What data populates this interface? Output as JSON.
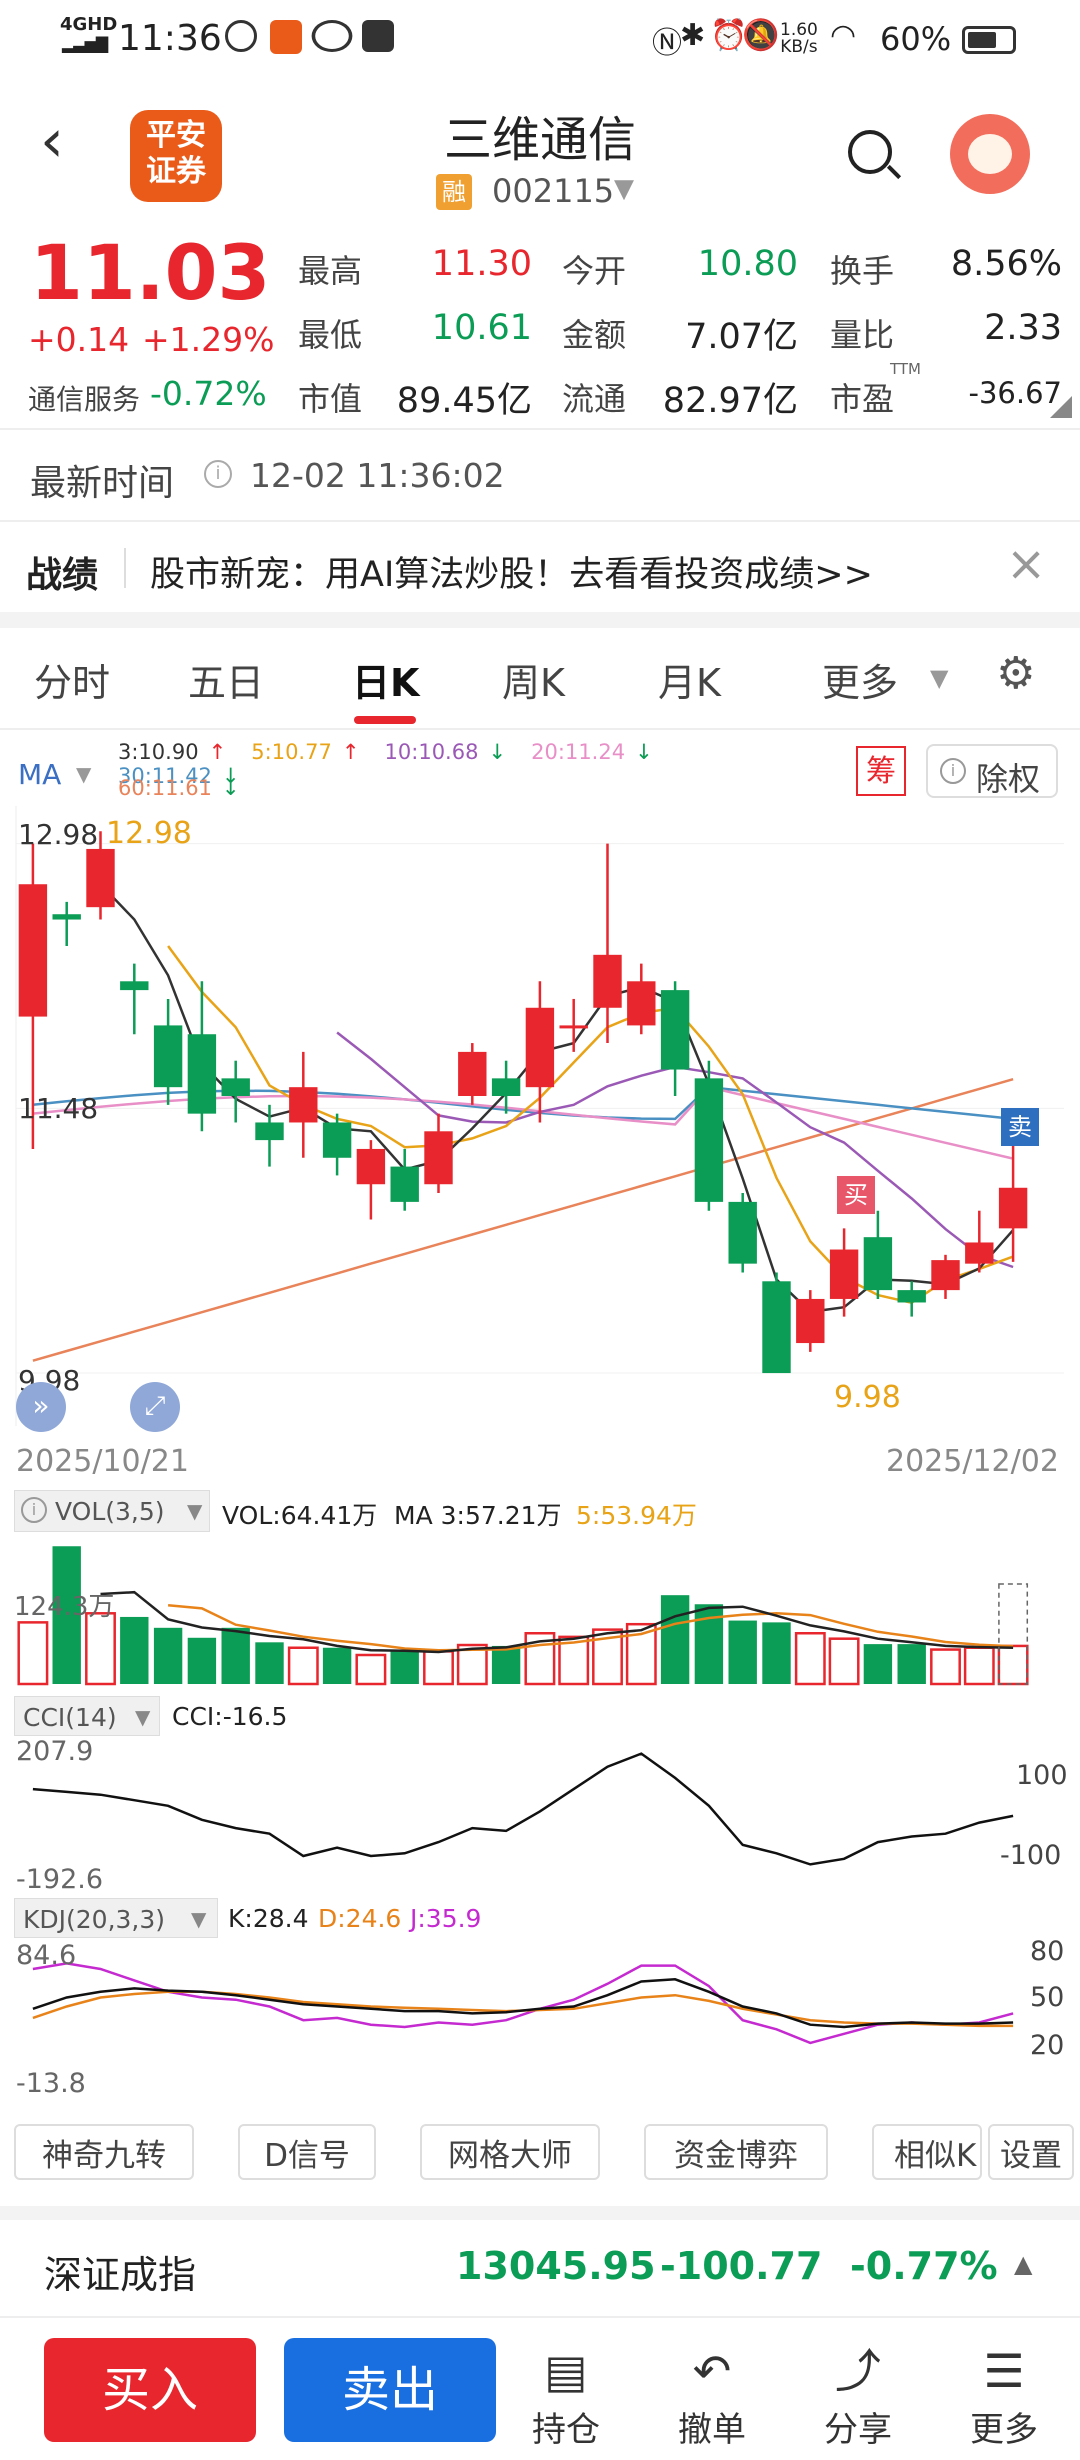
{
  "status_bar": {
    "network": "4GHD",
    "time": "11:36",
    "speed_value": "1.60",
    "speed_unit": "KB/s",
    "battery": "60%"
  },
  "header": {
    "logo_text": "平安\n证券",
    "stock_name": "三维通信",
    "margin_badge": "融",
    "stock_code": "002115"
  },
  "quote": {
    "price": "11.03",
    "change": "+0.14",
    "change_pct": "+1.29%",
    "sector": "通信服务",
    "sector_change": "-0.72%",
    "rows": [
      [
        {
          "label": "最高",
          "value": "11.30",
          "color": "red"
        },
        {
          "label": "今开",
          "value": "10.80",
          "color": "green"
        },
        {
          "label": "换手",
          "value": "8.56%",
          "color": "black"
        }
      ],
      [
        {
          "label": "最低",
          "value": "10.61",
          "color": "green"
        },
        {
          "label": "金额",
          "value": "7.07亿",
          "color": "black"
        },
        {
          "label": "量比",
          "value": "2.33",
          "color": "black"
        }
      ],
      [
        {
          "label": "市值",
          "value": "89.45亿",
          "color": "black"
        },
        {
          "label": "流通",
          "value": "82.97亿",
          "color": "black"
        },
        {
          "label": "市盈",
          "value": "-36.67",
          "color": "black",
          "sup": "TTM"
        }
      ]
    ],
    "update_label": "最新时间",
    "update_time": "12-02 11:36:02"
  },
  "promo": {
    "tag": "战绩",
    "text": "股市新宠：用AI算法炒股！去看看投资成绩>>"
  },
  "tabs": [
    {
      "label": "分时",
      "active": false
    },
    {
      "label": "五日",
      "active": false
    },
    {
      "label": "日K",
      "active": true
    },
    {
      "label": "周K",
      "active": false
    },
    {
      "label": "月K",
      "active": false
    },
    {
      "label": "更多",
      "active": false
    }
  ],
  "ma_legend": {
    "label": "MA",
    "items": [
      {
        "text": "3:10.90",
        "arrow": "↑",
        "color": "#333333"
      },
      {
        "text": "5:10.77",
        "arrow": "↑",
        "color": "#e8a317"
      },
      {
        "text": "10:10.68",
        "arrow": "↓",
        "color": "#9b59b6"
      },
      {
        "text": "20:11.24",
        "arrow": "↓",
        "color": "#e88fc7"
      },
      {
        "text": "30:11.42",
        "arrow": "↓",
        "color": "#4a90c2"
      },
      {
        "text": "60:11.61",
        "arrow": "↓",
        "color": "#e8835a"
      }
    ],
    "chip_label": "筹",
    "rights_label": "除权"
  },
  "chart_data": {
    "type": "candlestick",
    "y_axis_labels": [
      "12.98",
      "11.48",
      "9.98"
    ],
    "max_label": "12.98",
    "min_label": "9.98",
    "start_date": "2025/10/21",
    "end_date": "2025/12/02",
    "sell_marker": "卖",
    "buy_marker": "买",
    "candles": [
      {
        "o": 12.0,
        "c": 12.75,
        "h": 12.98,
        "l": 11.25
      },
      {
        "o": 12.58,
        "c": 12.55,
        "h": 12.65,
        "l": 12.4
      },
      {
        "o": 12.62,
        "c": 12.95,
        "h": 13.05,
        "l": 12.55
      },
      {
        "o": 12.2,
        "c": 12.15,
        "h": 12.3,
        "l": 11.9
      },
      {
        "o": 11.95,
        "c": 11.6,
        "h": 12.1,
        "l": 11.5
      },
      {
        "o": 11.9,
        "c": 11.45,
        "h": 12.2,
        "l": 11.35
      },
      {
        "o": 11.65,
        "c": 11.55,
        "h": 11.75,
        "l": 11.4
      },
      {
        "o": 11.4,
        "c": 11.3,
        "h": 11.5,
        "l": 11.15
      },
      {
        "o": 11.4,
        "c": 11.6,
        "h": 11.8,
        "l": 11.2
      },
      {
        "o": 11.4,
        "c": 11.2,
        "h": 11.45,
        "l": 11.1
      },
      {
        "o": 11.05,
        "c": 11.25,
        "h": 11.3,
        "l": 10.85
      },
      {
        "o": 11.15,
        "c": 10.95,
        "h": 11.25,
        "l": 10.9
      },
      {
        "o": 11.05,
        "c": 11.35,
        "h": 11.45,
        "l": 11.0
      },
      {
        "o": 11.55,
        "c": 11.8,
        "h": 11.85,
        "l": 11.5
      },
      {
        "o": 11.65,
        "c": 11.55,
        "h": 11.75,
        "l": 11.45
      },
      {
        "o": 11.6,
        "c": 12.05,
        "h": 12.2,
        "l": 11.4
      },
      {
        "o": 11.95,
        "c": 11.95,
        "h": 12.1,
        "l": 11.8
      },
      {
        "o": 12.05,
        "c": 12.35,
        "h": 12.98,
        "l": 11.85
      },
      {
        "o": 11.95,
        "c": 12.2,
        "h": 12.3,
        "l": 11.9
      },
      {
        "o": 12.15,
        "c": 11.7,
        "h": 12.2,
        "l": 11.55
      },
      {
        "o": 11.65,
        "c": 10.95,
        "h": 11.75,
        "l": 10.9
      },
      {
        "o": 10.95,
        "c": 10.6,
        "h": 11.0,
        "l": 10.55
      },
      {
        "o": 10.5,
        "c": 9.98,
        "h": 10.55,
        "l": 9.98
      },
      {
        "o": 10.15,
        "c": 10.4,
        "h": 10.45,
        "l": 10.1
      },
      {
        "o": 10.4,
        "c": 10.68,
        "h": 10.8,
        "l": 10.3
      },
      {
        "o": 10.75,
        "c": 10.45,
        "h": 10.9,
        "l": 10.4
      },
      {
        "o": 10.45,
        "c": 10.38,
        "h": 10.5,
        "l": 10.3
      },
      {
        "o": 10.45,
        "c": 10.62,
        "h": 10.65,
        "l": 10.4
      },
      {
        "o": 10.6,
        "c": 10.72,
        "h": 10.9,
        "l": 10.55
      },
      {
        "o": 10.8,
        "c": 11.03,
        "h": 11.3,
        "l": 10.61
      }
    ]
  },
  "volume": {
    "label": "VOL(3,5)",
    "value_text": "VOL:64.41万",
    "ma3_text": "MA 3:57.21万",
    "ma5_text": "5:53.94万",
    "axis_label": "124.3万"
  },
  "cci": {
    "label": "CCI(14)",
    "value_text": "CCI:-16.5",
    "max_label": "207.9",
    "min_label": "-192.6",
    "right_high": "100",
    "right_low": "-100"
  },
  "kdj": {
    "label": "KDJ(20,3,3)",
    "k_text": "K:28.4",
    "d_text": "D:24.6",
    "j_text": "J:35.9",
    "max_label": "84.6",
    "min_label": "-13.8",
    "right_labels": [
      "80",
      "50",
      "20"
    ]
  },
  "tools": [
    "神奇九转",
    "D信号",
    "网格大师",
    "资金博弈",
    "相似K",
    "设置"
  ],
  "index_bar": {
    "name": "深证成指",
    "value": "13045.95",
    "change": "-100.77",
    "change_pct": "-0.77%"
  },
  "bottom_nav": {
    "buy": "买入",
    "sell": "卖出",
    "items": [
      "持仓",
      "撤单",
      "分享",
      "更多"
    ]
  },
  "colors": {
    "up": "#e8262d",
    "down": "#0b9c55",
    "accent": "#e8262d",
    "sell_button": "#1a6fe0",
    "buy_button": "#e8262d"
  }
}
